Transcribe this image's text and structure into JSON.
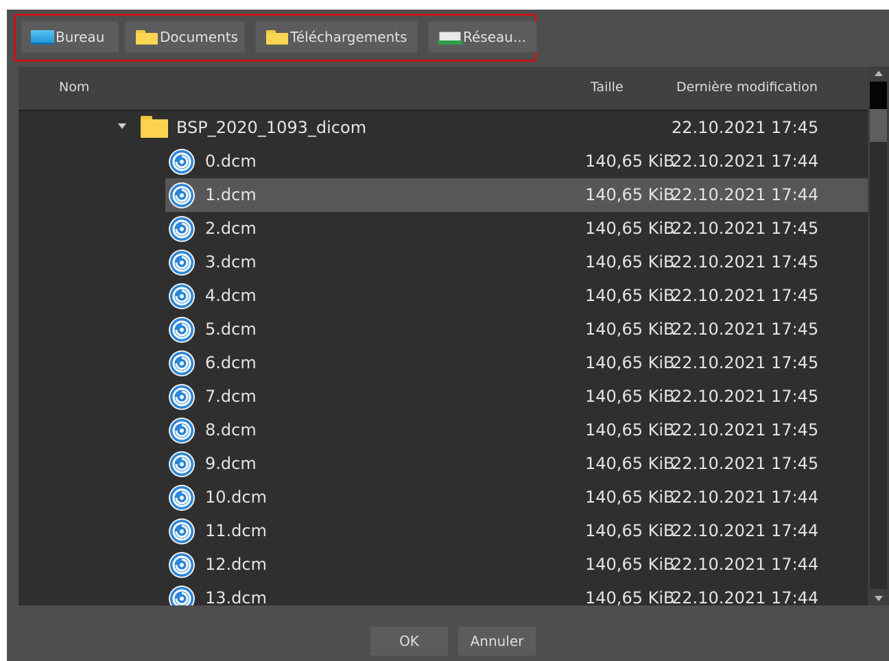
{
  "quick_access": [
    {
      "label": "Bureau",
      "icon": "desktop-icon"
    },
    {
      "label": "Documents",
      "icon": "folder-icon"
    },
    {
      "label": "Téléchargements",
      "icon": "folder-icon"
    },
    {
      "label": "Réseau...",
      "icon": "network-icon"
    }
  ],
  "columns": {
    "name": "Nom",
    "size": "Taille",
    "modified": "Dernière modification"
  },
  "folder": {
    "name": "BSP_2020_1093_dicom",
    "modified": "22.10.2021 17:45",
    "expanded": true
  },
  "files": [
    {
      "name": "0.dcm",
      "size": "140,65 KiB",
      "modified": "22.10.2021 17:44"
    },
    {
      "name": "1.dcm",
      "size": "140,65 KiB",
      "modified": "22.10.2021 17:44",
      "selected": true
    },
    {
      "name": "2.dcm",
      "size": "140,65 KiB",
      "modified": "22.10.2021 17:45"
    },
    {
      "name": "3.dcm",
      "size": "140,65 KiB",
      "modified": "22.10.2021 17:45"
    },
    {
      "name": "4.dcm",
      "size": "140,65 KiB",
      "modified": "22.10.2021 17:45"
    },
    {
      "name": "5.dcm",
      "size": "140,65 KiB",
      "modified": "22.10.2021 17:45"
    },
    {
      "name": "6.dcm",
      "size": "140,65 KiB",
      "modified": "22.10.2021 17:45"
    },
    {
      "name": "7.dcm",
      "size": "140,65 KiB",
      "modified": "22.10.2021 17:45"
    },
    {
      "name": "8.dcm",
      "size": "140,65 KiB",
      "modified": "22.10.2021 17:45"
    },
    {
      "name": "9.dcm",
      "size": "140,65 KiB",
      "modified": "22.10.2021 17:45"
    },
    {
      "name": "10.dcm",
      "size": "140,65 KiB",
      "modified": "22.10.2021 17:44"
    },
    {
      "name": "11.dcm",
      "size": "140,65 KiB",
      "modified": "22.10.2021 17:44"
    },
    {
      "name": "12.dcm",
      "size": "140,65 KiB",
      "modified": "22.10.2021 17:44"
    },
    {
      "name": "13.dcm",
      "size": "140,65 KiB",
      "modified": "22.10.2021 17:44"
    }
  ],
  "buttons": {
    "ok": "OK",
    "cancel": "Annuler"
  },
  "colors": {
    "highlight_border": "#c3141b",
    "selection": "#575757",
    "dialog_bg": "#4e4e4e",
    "list_bg": "#2f2f2f"
  }
}
